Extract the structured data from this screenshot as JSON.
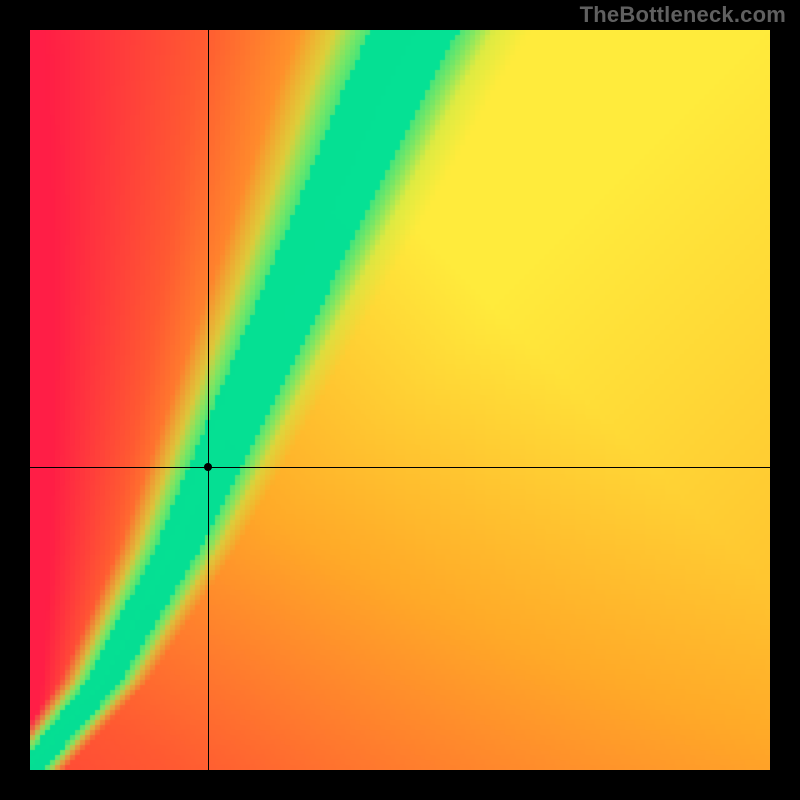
{
  "watermark": "TheBottleneck.com",
  "chart_data": {
    "type": "heatmap",
    "title": "",
    "xlabel": "",
    "ylabel": "",
    "xlim": [
      0,
      1
    ],
    "ylim": [
      0,
      1
    ],
    "color_scale": "red-orange-yellow-green",
    "grid": false,
    "legend": false,
    "crosshair": {
      "x": 0.24,
      "y": 0.41
    },
    "point": {
      "x": 0.24,
      "y": 0.41
    },
    "ridge": {
      "description": "green optimum band curving from lower-left toward upper-center",
      "control_points_xy": [
        [
          0.0,
          0.0
        ],
        [
          0.1,
          0.12
        ],
        [
          0.2,
          0.3
        ],
        [
          0.3,
          0.52
        ],
        [
          0.4,
          0.74
        ],
        [
          0.48,
          0.92
        ],
        [
          0.52,
          1.0
        ]
      ],
      "thickness_fraction": 0.03
    },
    "background_gradient": {
      "description": "diagonal red→orange→yellow warmth increasing toward upper-right; sharp green ridge on optimum"
    }
  }
}
